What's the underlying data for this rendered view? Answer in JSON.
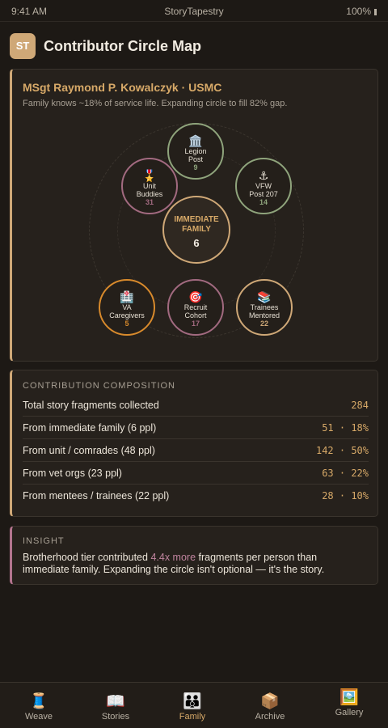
{
  "status": {
    "time": "9:41 AM",
    "app": "StoryTapestry",
    "battery": "100%"
  },
  "header": {
    "logo": "ST",
    "title": "Contributor Circle Map"
  },
  "person": {
    "name": "MSgt Raymond P. Kowalczyk · USMC",
    "subtitle": "Family knows ~18% of service life. Expanding circle to fill 82% gap."
  },
  "circle": {
    "center": {
      "label_line1": "IMMEDIATE",
      "label_line2": "FAMILY",
      "count": "6"
    },
    "nodes": [
      {
        "icon": "🏛️",
        "icon_name": "building-icon",
        "line1": "Legion",
        "line2": "Post",
        "count": "9",
        "color": "#8fa47c"
      },
      {
        "icon": "⚓",
        "icon_name": "anchor-icon",
        "line1": "VFW",
        "line2": "Post 207",
        "count": "14",
        "color": "#8fa47c"
      },
      {
        "icon": "🎖️",
        "icon_name": "medal-icon",
        "line1": "Unit",
        "line2": "Buddies",
        "count": "31",
        "color": "#a26a80"
      },
      {
        "icon": "🏥",
        "icon_name": "hospital-icon",
        "line1": "VA",
        "line2": "Caregivers",
        "count": "5",
        "color": "#d88a2c"
      },
      {
        "icon": "🎯",
        "icon_name": "target-icon",
        "line1": "Recruit",
        "line2": "Cohort",
        "count": "17",
        "color": "#a26a80"
      },
      {
        "icon": "📚",
        "icon_name": "books-icon",
        "line1": "Trainees",
        "line2": "Mentored",
        "count": "22",
        "color": "#cfa877"
      }
    ]
  },
  "composition": {
    "title": "CONTRIBUTION COMPOSITION",
    "rows": [
      {
        "label": "Total story fragments collected",
        "value": "284"
      },
      {
        "label": "From immediate family (6 ppl)",
        "value": "51 · 18%"
      },
      {
        "label": "From unit / comrades (48 ppl)",
        "value": "142 · 50%"
      },
      {
        "label": "From vet orgs (23 ppl)",
        "value": "63 · 22%"
      },
      {
        "label": "From mentees / trainees (22 ppl)",
        "value": "28 · 10%"
      }
    ]
  },
  "insight": {
    "title": "INSIGHT",
    "text_before": "Brotherhood tier contributed ",
    "highlight": "4.4x more",
    "text_after": " fragments per person than immediate family. Expanding the circle isn't optional — it's the story."
  },
  "tabs": [
    {
      "icon": "🧵",
      "icon_name": "thread-icon",
      "label": "Weave"
    },
    {
      "icon": "📖",
      "icon_name": "book-icon",
      "label": "Stories"
    },
    {
      "icon": "👪",
      "icon_name": "family-icon",
      "label": "Family",
      "active": true
    },
    {
      "icon": "📦",
      "icon_name": "box-icon",
      "label": "Archive"
    },
    {
      "icon": "🖼️",
      "icon_name": "picture-icon",
      "label": "Gallery"
    }
  ],
  "colors": {
    "accent": "#cfa877",
    "background": "#1d1915",
    "card": "#26211c",
    "insight_accent": "#b3748e"
  }
}
